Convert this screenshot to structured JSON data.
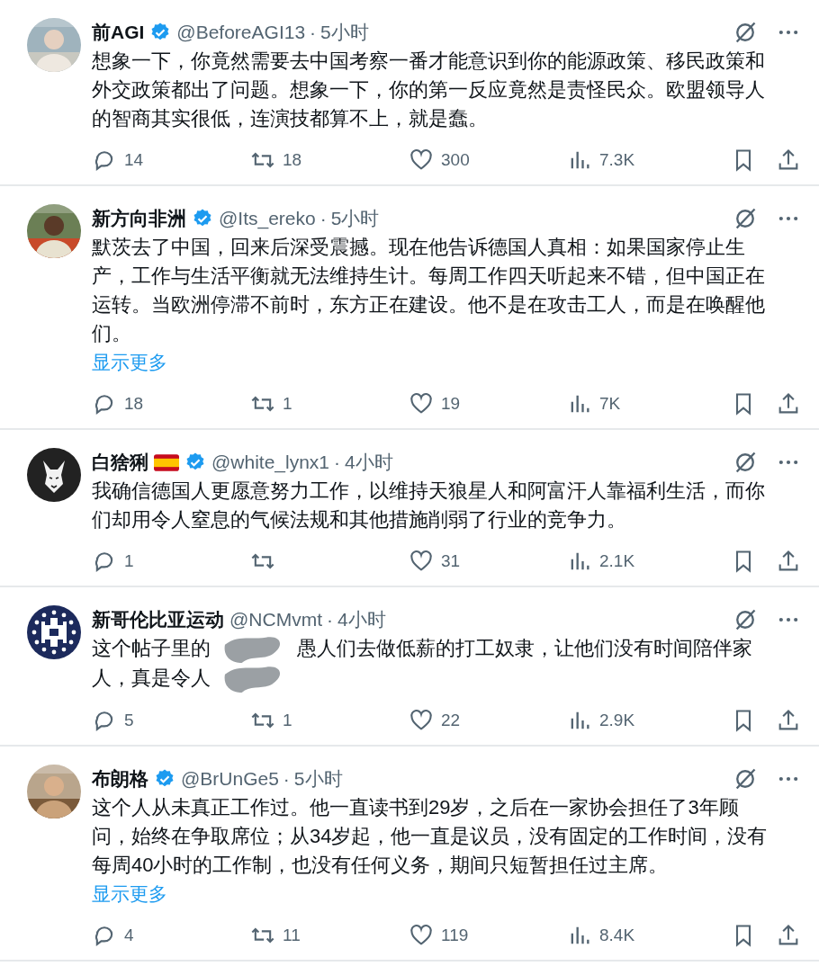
{
  "tweets": [
    {
      "name": "前AGI",
      "verified": true,
      "flag": false,
      "handle": "@BeforeAGI13",
      "separator": "·",
      "time": "5小时",
      "body": [
        {
          "kind": "text",
          "text": "想象一下，你竟然需要去中国考察一番才能意识到你的能源政策、移民政策和外交政策都出了问题。想象一下，你的第一反应竟然是责怪民众。欧盟领导人的智商其实很低，连演技都算不上，就是蠢。"
        }
      ],
      "replies": "14",
      "reposts": "18",
      "likes": "300",
      "views": "7.3K"
    },
    {
      "name": "新方向非洲",
      "verified": true,
      "flag": false,
      "handle": "@Its_ereko",
      "separator": "·",
      "time": "5小时",
      "body": [
        {
          "kind": "text",
          "text": "默茨去了中国，回来后深受震撼。现在他告诉德国人真相：如果国家停止生产，工作与生活平衡就无法维持生计。每周工作四天听起来不错，但中国正在运转。当欧洲停滞不前时，东方正在建设。他不是在攻击工人，而是在唤醒他们。"
        }
      ],
      "show_more": "显示更多",
      "replies": "18",
      "reposts": "1",
      "likes": "19",
      "views": "7K"
    },
    {
      "avatar": {
        "kind": "lynx"
      },
      "name": "白猞猁",
      "verified": true,
      "flag": true,
      "handle": "@white_lynx1",
      "separator": "·",
      "time": "4小时",
      "body": [
        {
          "kind": "text",
          "text": "我确信德国人更愿意努力工作，以维持天狼星人和阿富汗人靠福利生活，而你们却用令人窒息的气候法规和其他措施削弱了行业的竞争力。"
        }
      ],
      "replies": "1",
      "likes": "31",
      "views": "2.1K"
    },
    {
      "avatar": {
        "kind": "emblem"
      },
      "name": "新哥伦比亚运动",
      "verified": false,
      "flag": false,
      "handle": "@NCMvmt",
      "separator": "·",
      "time": "4小时",
      "body": [
        {
          "kind": "text",
          "text": "这个帖子里的"
        },
        {
          "kind": "smudge"
        },
        {
          "kind": "text",
          "text": "愚人们去做低薪的打工奴隶，让他们没有时间陪伴家"
        },
        {
          "kind": "text",
          "text": "人，真是令人"
        },
        {
          "kind": "smudge"
        }
      ],
      "replies": "5",
      "reposts": "1",
      "likes": "22",
      "views": "2.9K"
    },
    {
      "name": "布朗格",
      "verified": true,
      "flag": false,
      "handle": "@BrUnGe5",
      "separator": "·",
      "time": "5小时",
      "body": [
        {
          "kind": "text",
          "text": "这个人从未真正工作过。他一直读书到29岁，之后在一家协会担任了3年顾问，始终在争取席位；从34岁起，他一直是议员，没有固定的工作时间，没有每周40小时的工作制，也没有任何义务，期间只短暂担任过主席。"
        }
      ],
      "show_more": "显示更多",
      "replies": "4",
      "reposts": "11",
      "likes": "119",
      "views": "8.4K"
    }
  ]
}
